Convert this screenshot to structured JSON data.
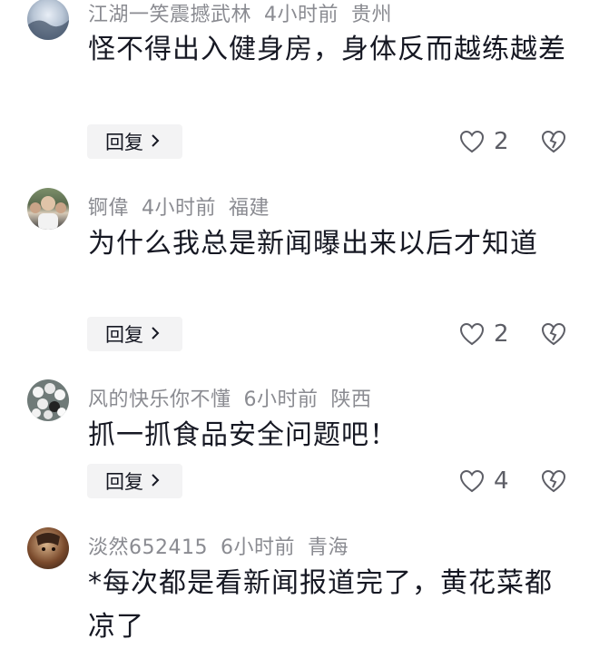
{
  "comments": [
    {
      "username": "江湖一笑震撼武林",
      "time": "4小时前",
      "location": "贵州",
      "text": "怪不得出入健身房，身体反而越练越差",
      "reply_label": "回复",
      "likes": "2"
    },
    {
      "username": "锕偉",
      "time": "4小时前",
      "location": "福建",
      "text": "为什么我总是新闻曝出来以后才知道",
      "reply_label": "回复",
      "likes": "2"
    },
    {
      "username": "风的快乐你不懂",
      "time": "6小时前",
      "location": "陕西",
      "text": "抓一抓食品安全问题吧！",
      "reply_label": "回复",
      "likes": "4"
    },
    {
      "username": "淡然652415",
      "time": "6小时前",
      "location": "青海",
      "text": "*每次都是看新闻报道完了，黄花菜都凉了"
    }
  ],
  "icons": {
    "like": "heart-outline-icon",
    "dislike": "broken-heart-icon",
    "reply_chevron": "chevron-right-icon"
  },
  "colors": {
    "meta_text": "#8a8b91",
    "body_text": "#161823",
    "reply_bg": "#f3f3f4"
  }
}
